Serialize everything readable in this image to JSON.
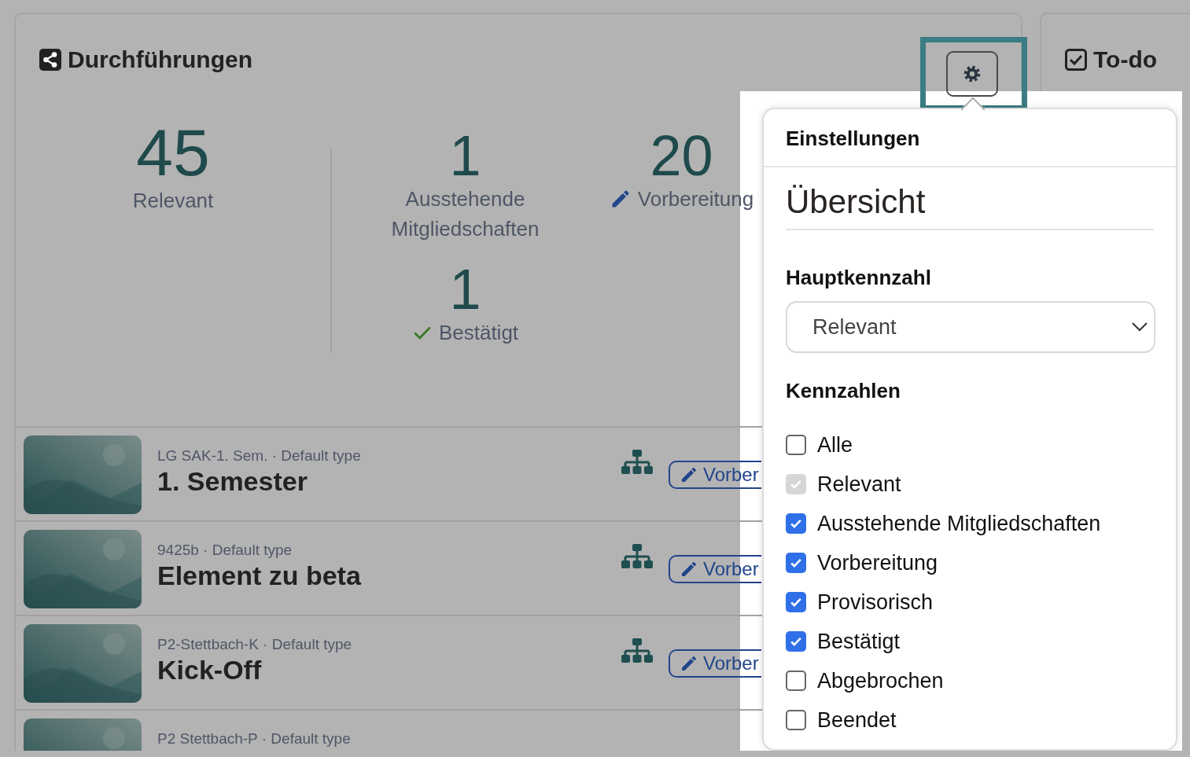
{
  "card": {
    "title": "Durchführungen",
    "settings_button": {
      "highlighted": true
    }
  },
  "stats": [
    {
      "value": "45",
      "label": "Relevant",
      "kind": "main"
    },
    {
      "value": "1",
      "label": "Ausstehende Mitgliedschaften",
      "kind": "plain"
    },
    {
      "value": "20",
      "label": "Vorbereitung",
      "kind": "draft"
    },
    {
      "value": "1",
      "label": "Bestätigt",
      "kind": "confirmed"
    }
  ],
  "rows": [
    {
      "subtitle": "LG SAK-1. Sem. · Default type",
      "title": "1. Semester",
      "status": "Vorber"
    },
    {
      "subtitle": "9425b · Default type",
      "title": "Element zu beta",
      "status": "Vorber"
    },
    {
      "subtitle": "P2-Stettbach-K · Default type",
      "title": "Kick-Off",
      "status": "Vorber"
    },
    {
      "subtitle": "P2 Stettbach-P · Default type"
    }
  ],
  "todo": {
    "title": "To-do"
  },
  "popover": {
    "title": "Einstellungen",
    "section": "Übersicht",
    "main_label": "Hauptkennzahl",
    "main_value": "Relevant",
    "list_label": "Kennzahlen",
    "options": [
      {
        "label": "Alle",
        "checked": false,
        "disabled": false
      },
      {
        "label": "Relevant",
        "checked": true,
        "disabled": true
      },
      {
        "label": "Ausstehende Mitgliedschaften",
        "checked": true,
        "disabled": false
      },
      {
        "label": "Vorbereitung",
        "checked": true,
        "disabled": false
      },
      {
        "label": "Provisorisch",
        "checked": true,
        "disabled": false
      },
      {
        "label": "Bestätigt",
        "checked": true,
        "disabled": false
      },
      {
        "label": "Abgebrochen",
        "checked": false,
        "disabled": false
      },
      {
        "label": "Beendet",
        "checked": false,
        "disabled": false
      }
    ]
  }
}
